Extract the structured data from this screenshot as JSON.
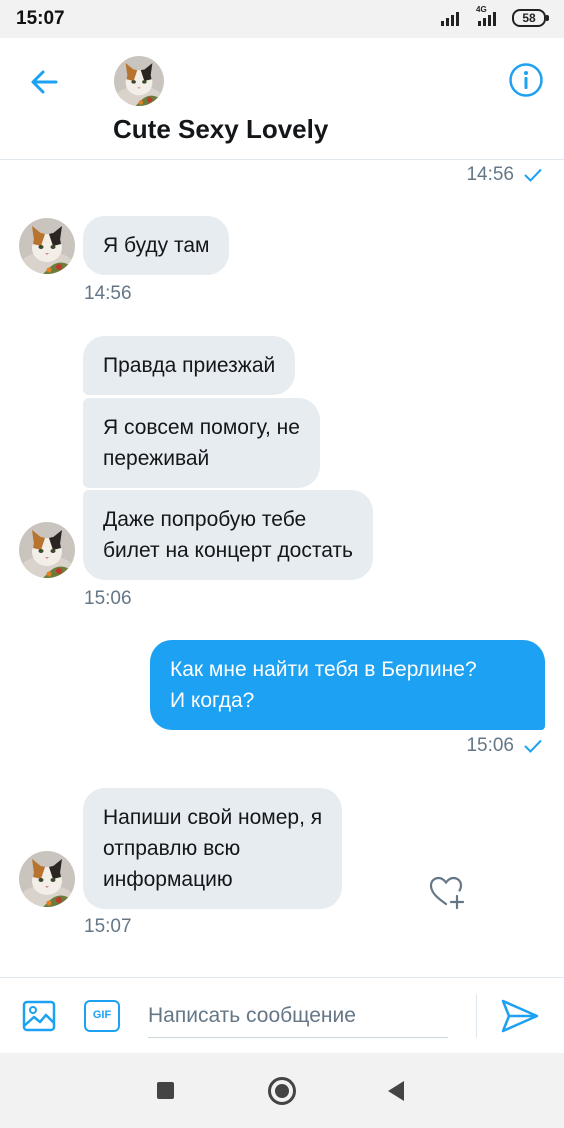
{
  "status_bar": {
    "time": "15:07",
    "network_type": "4G",
    "battery_level": "58"
  },
  "header": {
    "contact_name": "Cute Sexy Lovely",
    "back_icon": "arrow-left-icon",
    "info_icon": "info-icon",
    "accent_color": "#1da1f2"
  },
  "conversation": {
    "top_timestamp": "14:56",
    "groups": [
      {
        "direction": "received",
        "messages": [
          "Я буду там"
        ],
        "timestamp": "14:56"
      },
      {
        "direction": "received",
        "messages": [
          "Правда приезжай",
          "Я совсем помогу, не\nпереживай",
          "Даже попробую тебе\nбилет на концерт достать"
        ],
        "timestamp": "15:06"
      },
      {
        "direction": "sent",
        "messages": [
          "Как мне найти тебя в Берлине?\nИ когда?"
        ],
        "timestamp": "15:06"
      },
      {
        "direction": "received",
        "messages": [
          "Напиши свой номер, я\nотправлю всю\nинформацию"
        ],
        "timestamp": "15:07"
      }
    ]
  },
  "composer": {
    "placeholder": "Написать сообщение",
    "gif_label": "GIF",
    "image_icon": "image-icon",
    "send_icon": "send-icon"
  },
  "nav_bar": {
    "icons": [
      "recent-apps-icon",
      "home-icon",
      "back-icon"
    ]
  },
  "colors": {
    "received_bubble": "#e6ecf0",
    "sent_bubble": "#1da1f2",
    "timestamp": "#657786"
  }
}
